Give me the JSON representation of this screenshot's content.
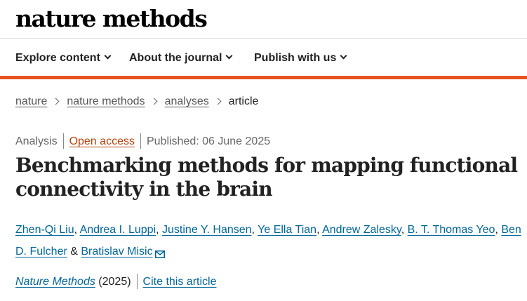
{
  "header": {
    "logo": "nature methods"
  },
  "nav": {
    "items": [
      {
        "label": "Explore content"
      },
      {
        "label": "About the journal"
      },
      {
        "label": "Publish with us"
      }
    ]
  },
  "breadcrumb": {
    "items": [
      "nature",
      "nature methods",
      "analyses"
    ],
    "current": "article"
  },
  "article": {
    "type": "Analysis",
    "access": "Open access",
    "published": "Published: 06 June 2025",
    "title": "Benchmarking methods for mapping functional connectivity in the brain",
    "authors": [
      "Zhen-Qi Liu",
      "Andrea I. Luppi",
      "Justine Y. Hansen",
      "Ye Ella Tian",
      "Andrew Zalesky",
      "B. T. Thomas Yeo",
      "Ben D. Fulcher",
      "Bratislav Misic"
    ],
    "journal": "Nature Methods",
    "year": "(2025)",
    "cite": "Cite this article"
  },
  "colors": {
    "accent": "#e6521f",
    "link": "#006699",
    "open_access": "#b5420b"
  },
  "icons": {
    "mail": "envelope-icon"
  }
}
